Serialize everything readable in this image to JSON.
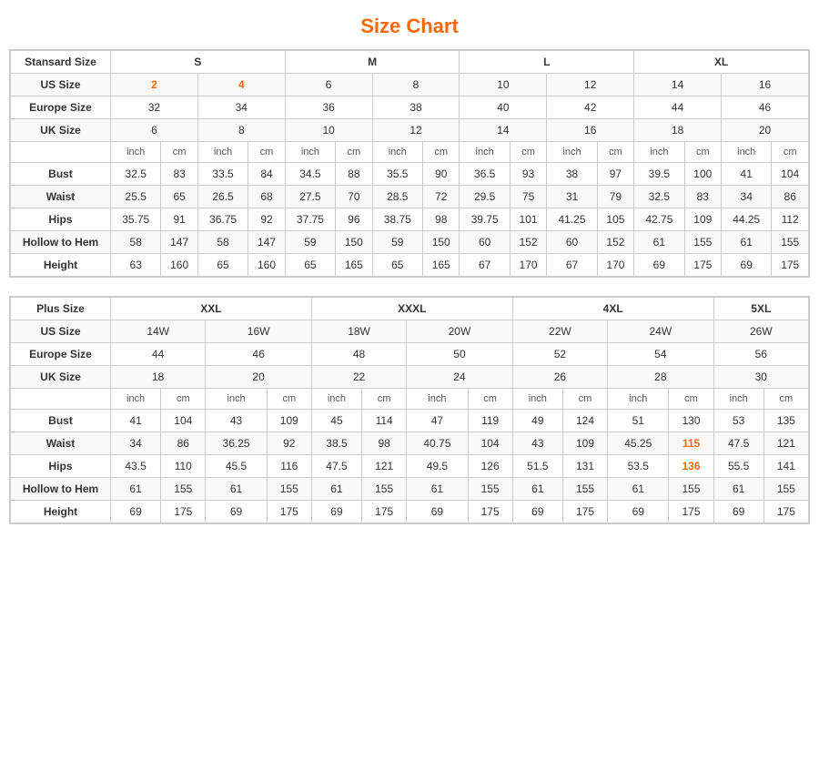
{
  "title": "Size Chart",
  "standard": {
    "table_title": "Stansard Size",
    "size_groups": [
      "S",
      "M",
      "L",
      "XL"
    ],
    "us_sizes": [
      "2",
      "4",
      "6",
      "8",
      "10",
      "12",
      "14",
      "16"
    ],
    "europe_sizes": [
      "32",
      "34",
      "36",
      "38",
      "40",
      "42",
      "44",
      "46"
    ],
    "uk_sizes": [
      "6",
      "8",
      "10",
      "12",
      "14",
      "16",
      "18",
      "20"
    ],
    "unit_row": [
      "inch",
      "cm",
      "inch",
      "cm",
      "inch",
      "cm",
      "inch",
      "cm",
      "inch",
      "cm",
      "inch",
      "cm",
      "inch",
      "cm",
      "inch",
      "cm"
    ],
    "rows": [
      {
        "label": "Bust",
        "vals": [
          "32.5",
          "83",
          "33.5",
          "84",
          "34.5",
          "88",
          "35.5",
          "90",
          "36.5",
          "93",
          "38",
          "97",
          "39.5",
          "100",
          "41",
          "104"
        ]
      },
      {
        "label": "Waist",
        "vals": [
          "25.5",
          "65",
          "26.5",
          "68",
          "27.5",
          "70",
          "28.5",
          "72",
          "29.5",
          "75",
          "31",
          "79",
          "32.5",
          "83",
          "34",
          "86"
        ]
      },
      {
        "label": "Hips",
        "vals": [
          "35.75",
          "91",
          "36.75",
          "92",
          "37.75",
          "96",
          "38.75",
          "98",
          "39.75",
          "101",
          "41.25",
          "105",
          "42.75",
          "109",
          "44.25",
          "112"
        ]
      },
      {
        "label": "Hollow to Hem",
        "vals": [
          "58",
          "147",
          "58",
          "147",
          "59",
          "150",
          "59",
          "150",
          "60",
          "152",
          "60",
          "152",
          "61",
          "155",
          "61",
          "155"
        ]
      },
      {
        "label": "Height",
        "vals": [
          "63",
          "160",
          "65",
          "160",
          "65",
          "165",
          "65",
          "165",
          "67",
          "170",
          "67",
          "170",
          "69",
          "175",
          "69",
          "175"
        ]
      }
    ]
  },
  "plus": {
    "table_title": "Plus Size",
    "size_groups": [
      "XXL",
      "XXXL",
      "4XL",
      "5XL"
    ],
    "us_sizes": [
      "14W",
      "16W",
      "18W",
      "20W",
      "22W",
      "24W",
      "26W"
    ],
    "europe_sizes": [
      "44",
      "46",
      "48",
      "50",
      "52",
      "54",
      "56"
    ],
    "uk_sizes": [
      "18",
      "20",
      "22",
      "24",
      "26",
      "28",
      "30"
    ],
    "unit_row": [
      "inch",
      "cm",
      "inch",
      "cm",
      "inch",
      "cm",
      "inch",
      "cm",
      "inch",
      "cm",
      "inch",
      "cm",
      "inch",
      "cm"
    ],
    "rows": [
      {
        "label": "Bust",
        "vals": [
          "41",
          "104",
          "43",
          "109",
          "45",
          "114",
          "47",
          "119",
          "49",
          "124",
          "51",
          "130",
          "53",
          "135"
        ]
      },
      {
        "label": "Waist",
        "vals": [
          "34",
          "86",
          "36.25",
          "92",
          "38.5",
          "98",
          "40.75",
          "104",
          "43",
          "109",
          "45.25",
          "115",
          "47.5",
          "121"
        ]
      },
      {
        "label": "Hips",
        "vals": [
          "43.5",
          "110",
          "45.5",
          "116",
          "47.5",
          "121",
          "49.5",
          "126",
          "51.5",
          "131",
          "53.5",
          "136",
          "55.5",
          "141"
        ]
      },
      {
        "label": "Hollow to Hem",
        "vals": [
          "61",
          "155",
          "61",
          "155",
          "61",
          "155",
          "61",
          "155",
          "61",
          "155",
          "61",
          "155",
          "61",
          "155"
        ]
      },
      {
        "label": "Height",
        "vals": [
          "69",
          "175",
          "69",
          "175",
          "69",
          "175",
          "69",
          "175",
          "69",
          "175",
          "69",
          "175",
          "69",
          "175"
        ]
      }
    ]
  }
}
